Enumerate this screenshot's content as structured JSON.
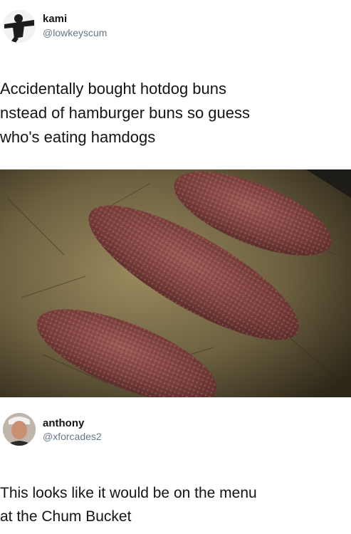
{
  "tweet": {
    "author_name": "kami",
    "author_handle": "@lowkeyscum",
    "text": "Accidentally bought hotdog buns\nnstead of hamburger buns so guess\nwho's eating hamdogs"
  },
  "photo": {
    "subject": "hamdogs-photo"
  },
  "reply": {
    "author_name": "anthony",
    "author_handle": "@xforcades2",
    "text": "This looks like it would be on the menu\nat the Chum Bucket"
  }
}
